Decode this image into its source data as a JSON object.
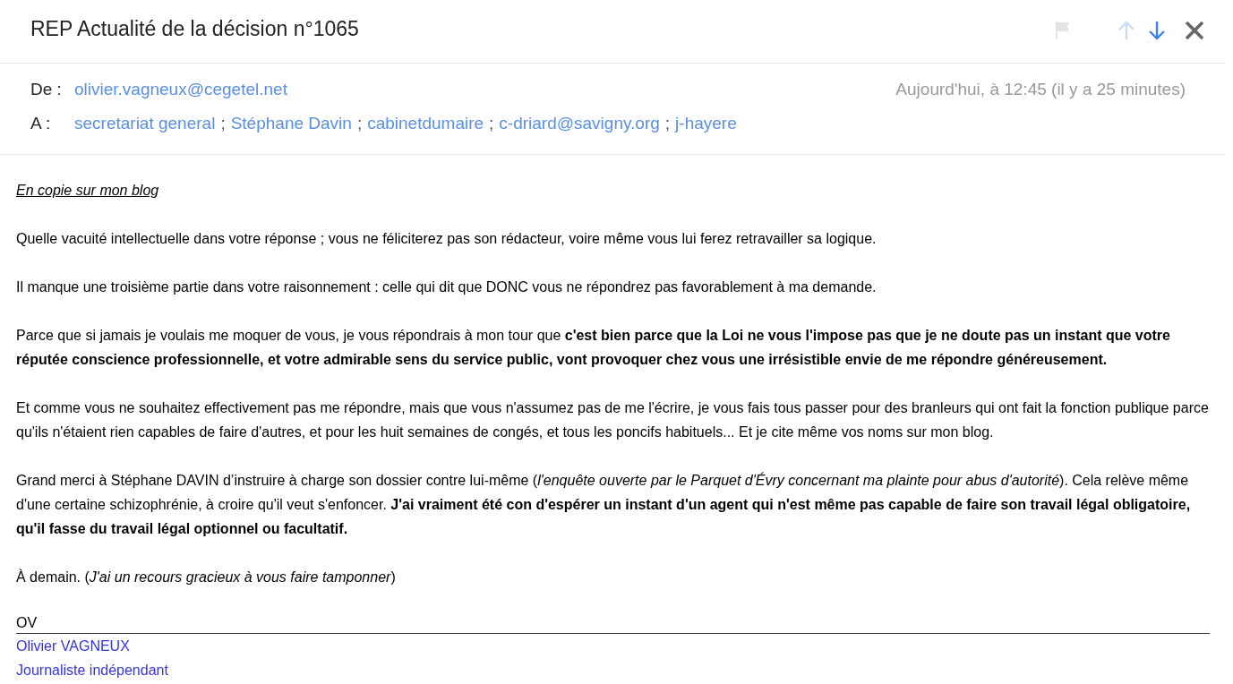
{
  "header": {
    "title": "REP Actualité de la décision n°1065",
    "flag": {
      "disabled": true
    },
    "previous": {
      "disabled": true
    },
    "next": {
      "disabled": false
    }
  },
  "from": {
    "label": "De :",
    "address": "olivier.vagneux@cegetel.net",
    "date": "Aujourd'hui, à 12:45 (il y a 25 minutes)"
  },
  "to": {
    "label": "A :",
    "separator": ";",
    "recipients": [
      "secretariat general",
      "Stéphane Davin",
      "cabinetdumaire",
      "c-driard@savigny.org",
      "j-hayere"
    ]
  },
  "body": {
    "blog_link": "En copie sur mon blog",
    "paragraphs": [
      "Quelle vacuité intellectuelle dans votre réponse ; vous ne féliciterez pas son rédacteur, voire même vous lui ferez retravailler sa logique.",
      "Il manque une troisième partie dans votre raisonnement : celle qui dit que DONC vous ne répondrez pas favorablement à ma demande.",
      "Parce que si jamais je voulais me moquer de vous, je vous répondrais à mon tour que **c'est bien parce que la Loi ne vous l'impose pas que je ne doute pas un instant que votre réputée conscience professionnelle, et votre admirable sens du service public, vont provoquer chez vous une irrésistible envie de me répondre généreusement.**",
      "Et comme vous ne souhaitez effectivement pas me répondre, mais que vous n'assumez pas de me l'écrire, je vous fais tous passer pour des branleurs qui ont fait la fonction publique parce qu'ils n'étaient rien capables de faire d'autres, et pour les huit semaines de congés, et tous les poncifs habituels... Et je cite même vos noms sur mon blog.",
      "Grand merci à Stéphane DAVIN d’instruire à charge son dossier contre lui-même (*l'enquête ouverte par le Parquet d'Évry concernant ma plainte pour abus d'autorité*). Cela relève même d'une certaine schizophrénie, à croire qu'il veut s'enfoncer. **J'ai vraiment été con d'espérer un instant d'un agent qui n'est même pas capable de faire son travail légal obligatoire, qu'il fasse du travail légal optionnel ou facultatif.**",
      "À demain. (*J'ai un recours gracieux à vous faire tamponner*)"
    ],
    "initials": "OV",
    "signature": [
      "Olivier VAGNEUX",
      "Journaliste indépendant"
    ]
  }
}
